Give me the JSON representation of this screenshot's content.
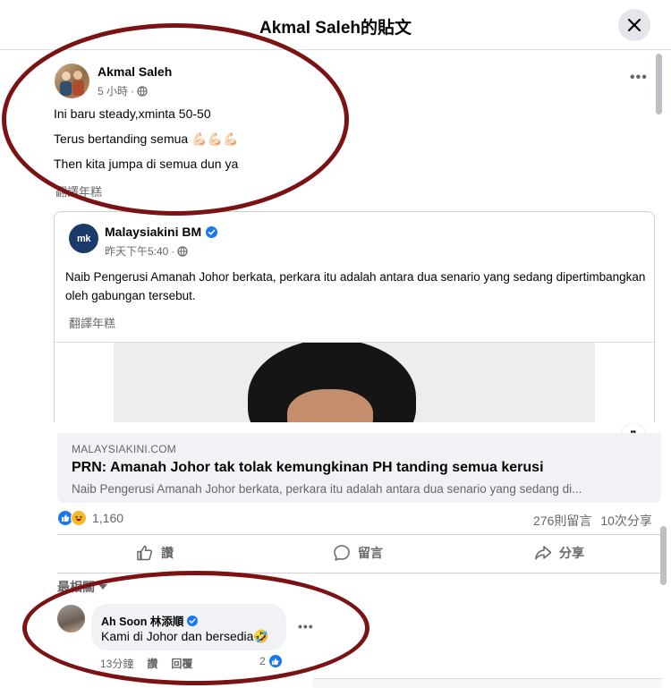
{
  "dialog": {
    "title": "Akmal Saleh的貼文",
    "close_icon": "close-icon"
  },
  "post": {
    "author": "Akmal Saleh",
    "time": "5 小時",
    "visibility_icon": "globe-icon",
    "lines": [
      "Ini baru steady,xminta 50-50",
      "Terus bertanding semua 💪🏻💪🏻💪🏻",
      "Then kita jumpa di semua dun ya"
    ],
    "translate_label": "翻譯年糕",
    "more_label": "•••"
  },
  "shared": {
    "source_name": "Malaysiakini BM",
    "logo_text": "mk",
    "verified_icon": "verified-badge-icon",
    "time": "昨天下午5:40",
    "text": "Naib Pengerusi Amanah Johor berkata, perkara itu adalah antara dua senario yang sedang dipertimbangkan oleh gabungan tersebut.",
    "translate_label": "翻譯年糕"
  },
  "link_preview": {
    "domain": "MALAYSIAKINI.COM",
    "title": "PRN: Amanah Johor tak tolak kemungkinan PH tanding semua kerusi",
    "description": "Naib Pengerusi Amanah Johor berkata, perkara itu adalah antara dua senario yang sedang di...",
    "badge_glyph": "❞"
  },
  "engagement": {
    "reaction_count": "1,160",
    "reaction_icons": [
      "like-icon",
      "haha-icon"
    ],
    "comments": "276則留言",
    "shares": "10次分享"
  },
  "actions": {
    "like": "讚",
    "comment": "留言",
    "share": "分享"
  },
  "comments_section": {
    "sort_label": "最相關",
    "comment": {
      "author": "Ah Soon 林添順",
      "text": "Kami di Johor dan bersedia🤣",
      "time": "13分鐘",
      "like": "讚",
      "reply": "回覆",
      "reaction_count": "2",
      "more_label": "•••"
    }
  },
  "colors": {
    "facebook_blue": "#1877f2",
    "annotation_red": "#7b1314",
    "secondary_text": "#65676b"
  }
}
